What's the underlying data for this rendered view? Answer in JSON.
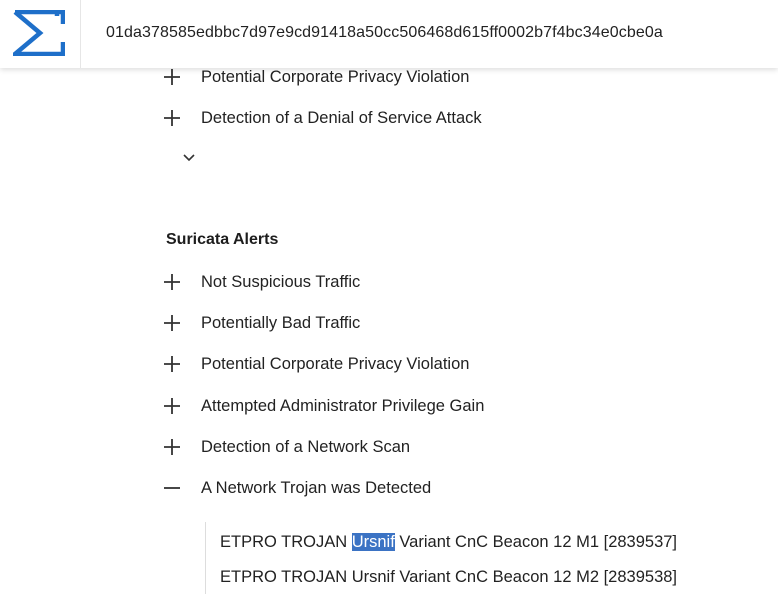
{
  "header": {
    "hash": "01da378585edbbc7d97e9cd91418a50cc506468d615ff0002b7f4bc34e0cbe0a",
    "logo_icon": "sigma-icon",
    "accent_color": "#1e6fc9"
  },
  "upper_rules": [
    {
      "label": "Potential Corporate Privacy Violation",
      "state": "collapsed"
    },
    {
      "label": "Detection of a Denial of Service Attack",
      "state": "collapsed"
    }
  ],
  "suricata": {
    "title": "Suricata Alerts",
    "items": [
      {
        "label": "Not Suspicious Traffic",
        "state": "collapsed"
      },
      {
        "label": "Potentially Bad Traffic",
        "state": "collapsed"
      },
      {
        "label": "Potential Corporate Privacy Violation",
        "state": "collapsed"
      },
      {
        "label": "Attempted Administrator Privilege Gain",
        "state": "collapsed"
      },
      {
        "label": "Detection of a Network Scan",
        "state": "collapsed"
      },
      {
        "label": "A Network Trojan was Detected",
        "state": "expanded"
      }
    ],
    "details": [
      {
        "pre": "ETPRO TROJAN ",
        "highlight": "Ursnif",
        "post": " Variant CnC Beacon 12 M1 [2839537]"
      },
      {
        "text": "ETPRO TROJAN Ursnif Variant CnC Beacon 12 M2 [2839538]"
      }
    ]
  }
}
